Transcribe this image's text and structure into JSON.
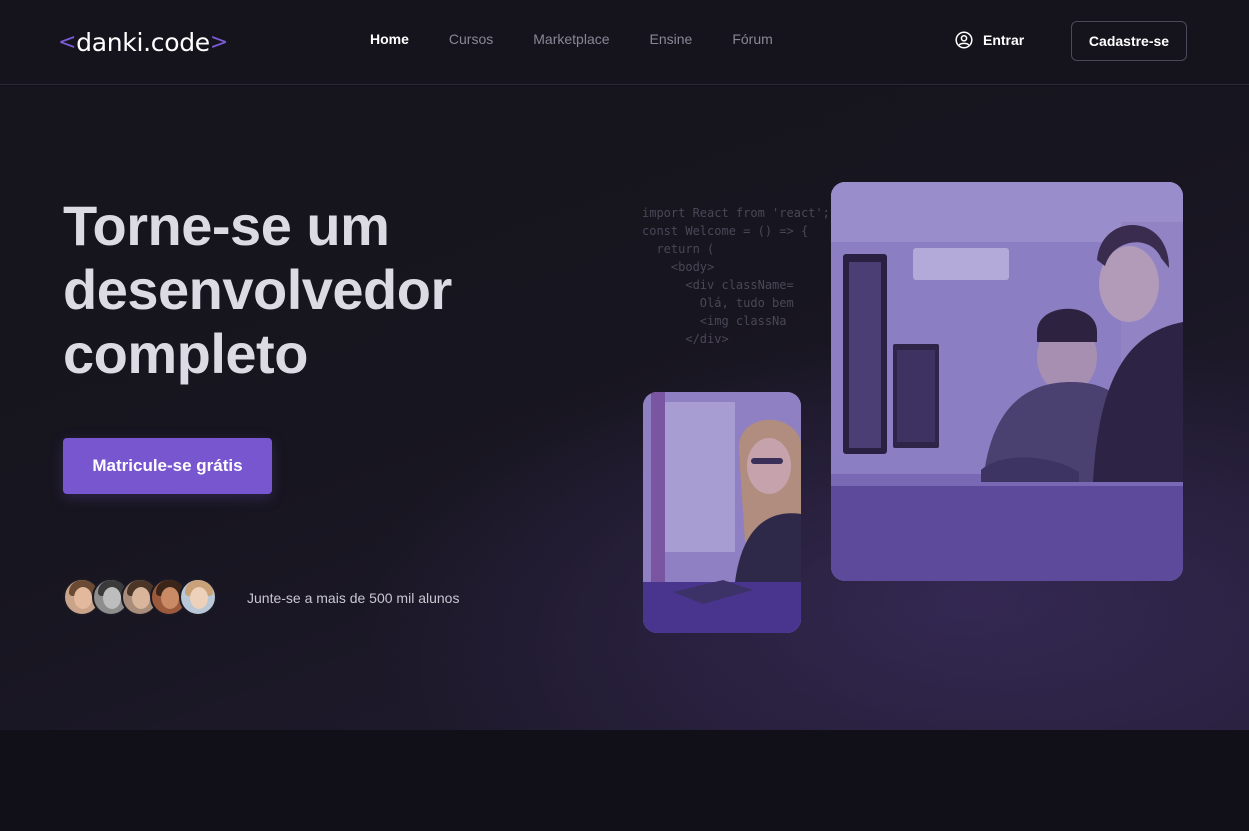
{
  "header": {
    "logo": {
      "open": "<",
      "name": "danki",
      "dot": ".",
      "suffix": "code",
      "close": ">"
    },
    "nav": [
      {
        "label": "Home",
        "active": true
      },
      {
        "label": "Cursos",
        "active": false
      },
      {
        "label": "Marketplace",
        "active": false
      },
      {
        "label": "Ensine",
        "active": false
      },
      {
        "label": "Fórum",
        "active": false
      }
    ],
    "login_label": "Entrar",
    "signup_label": "Cadastre-se"
  },
  "hero": {
    "title_lines": [
      "Torne-se um",
      "desenvolvedor",
      "completo"
    ],
    "cta_label": "Matricule-se grátis",
    "social_proof": "Junte-se a mais de 500 mil alunos",
    "code_lines": [
      "import React from 'react';",
      "",
      "const Welcome = () => {",
      "  return (",
      "    <body>",
      "      <div className=",
      "        Olá, tudo bem",
      "        <img classNa",
      "      </div>"
    ]
  },
  "colors": {
    "accent": "#7856d0",
    "background": "#111018",
    "header_bg": "#15141c"
  }
}
